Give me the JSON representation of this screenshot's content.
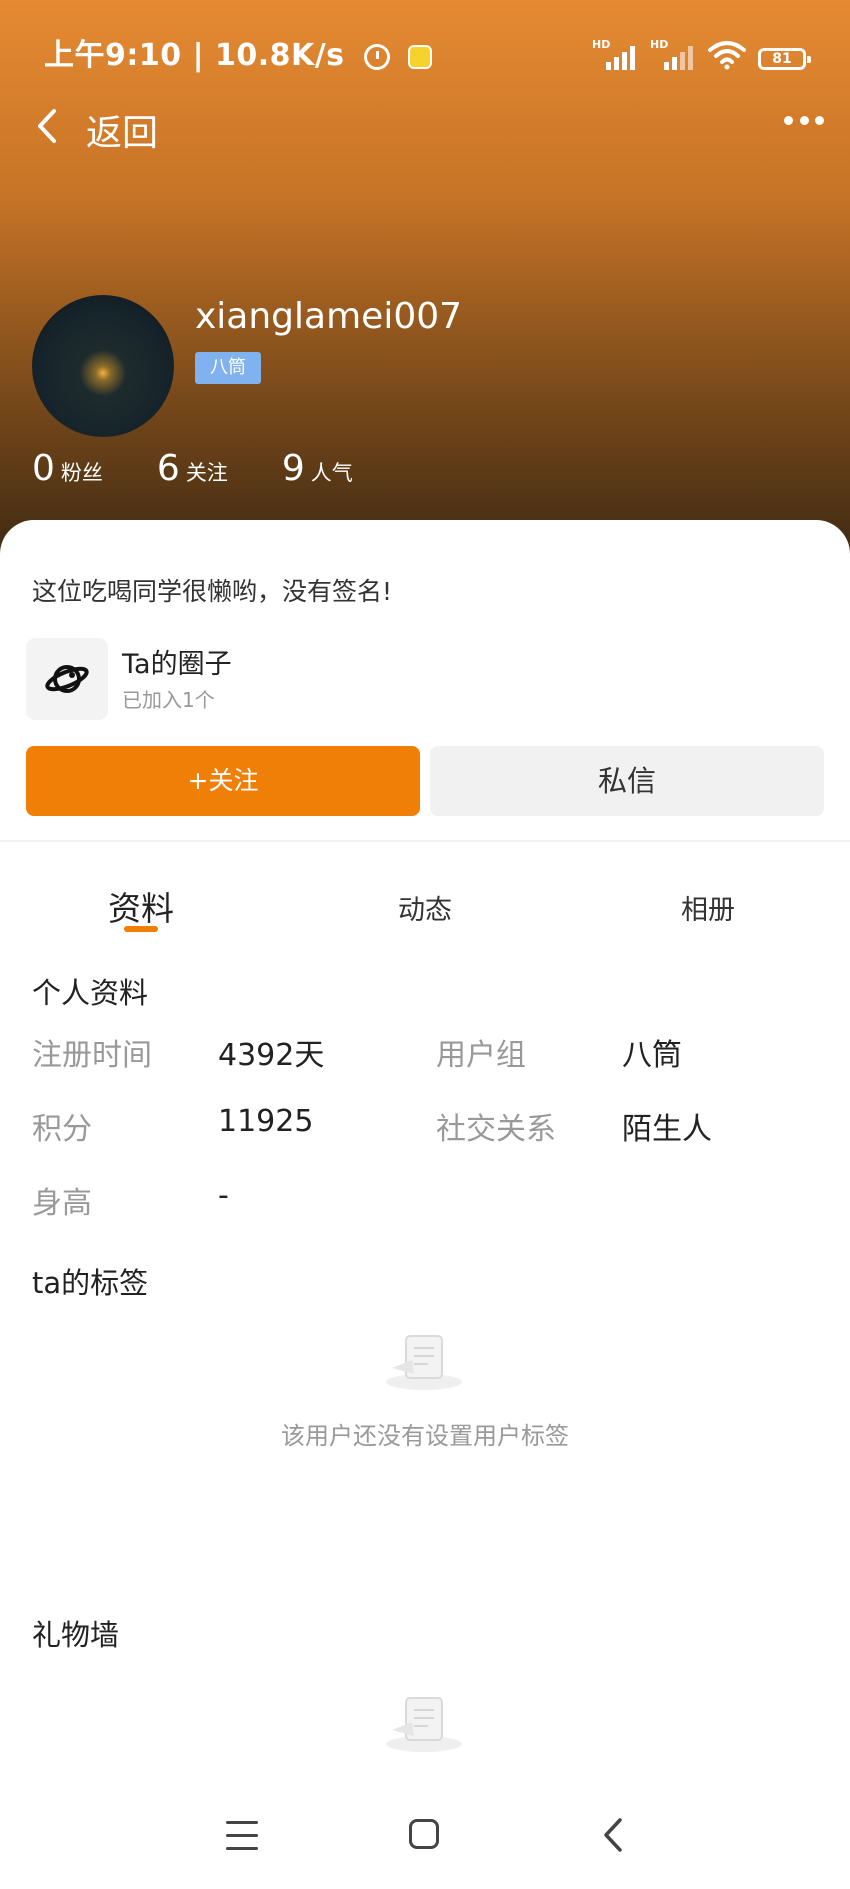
{
  "status_bar": {
    "time_speed": "上午9:10 | 10.8K/s",
    "signal1_label": "HD",
    "signal2_label": "HD",
    "battery": "81",
    "icons": [
      "alarm-icon",
      "app-notification-icon",
      "signal-icon",
      "wifi-icon",
      "battery-icon"
    ]
  },
  "nav": {
    "back_label": "返回",
    "more_icon": "more-dots-icon"
  },
  "profile": {
    "username": "xianglamei007",
    "badge": "八筒",
    "stats": [
      {
        "num": "0",
        "label": "粉丝"
      },
      {
        "num": "6",
        "label": "关注"
      },
      {
        "num": "9",
        "label": "人气"
      }
    ],
    "signature": "这位吃喝同学很懒哟，没有签名!",
    "circle": {
      "title": "Ta的圈子",
      "subtitle": "已加入1个"
    }
  },
  "actions": {
    "follow": "+关注",
    "message": "私信"
  },
  "tabs": [
    "资料",
    "动态",
    "相册"
  ],
  "personal_info": {
    "title": "个人资料",
    "rows": [
      {
        "label": "注册时间",
        "value": "4392天"
      },
      {
        "label": "用户组",
        "value": "八筒"
      },
      {
        "label": "积分",
        "value": "11925"
      },
      {
        "label": "社交关系",
        "value": "陌生人"
      },
      {
        "label": "身高",
        "value": "-"
      }
    ]
  },
  "tags": {
    "title": "ta的标签",
    "empty_text": "该用户还没有设置用户标签"
  },
  "gifts": {
    "title": "礼物墙"
  },
  "colors": {
    "accent": "#f07f08",
    "header_top": "#e58a33",
    "header_bottom": "#3d2912",
    "badge": "#7fb2ee"
  }
}
